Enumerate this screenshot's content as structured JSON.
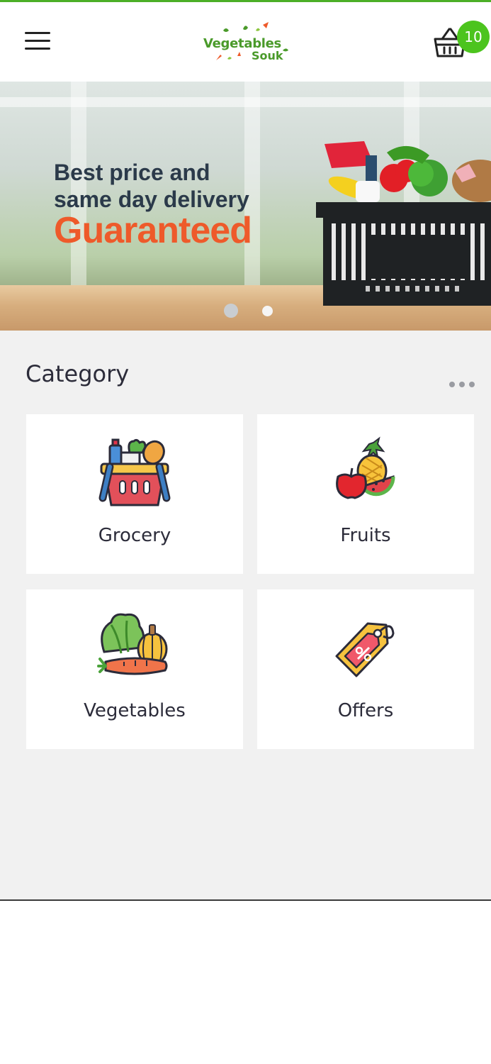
{
  "header": {
    "logo": {
      "line1": "Vegetables",
      "line2": "Souk"
    },
    "cart": {
      "count": "10"
    }
  },
  "banner": {
    "line1": "Best price and",
    "line2": "same day delivery",
    "highlight": "Guaranteed",
    "slides_total": 2,
    "active_slide": 1
  },
  "category": {
    "title": "Category",
    "items": [
      {
        "label": "Grocery",
        "icon": "grocery-basket-icon"
      },
      {
        "label": "Fruits",
        "icon": "fruits-icon"
      },
      {
        "label": "Vegetables",
        "icon": "vegetables-icon"
      },
      {
        "label": "Offers",
        "icon": "offer-tag-icon"
      }
    ]
  },
  "colors": {
    "brand_green": "#4a9a2a",
    "badge_green": "#4cc41e",
    "highlight_orange": "#ee5a2a",
    "page_background": "#f1f1f1"
  }
}
